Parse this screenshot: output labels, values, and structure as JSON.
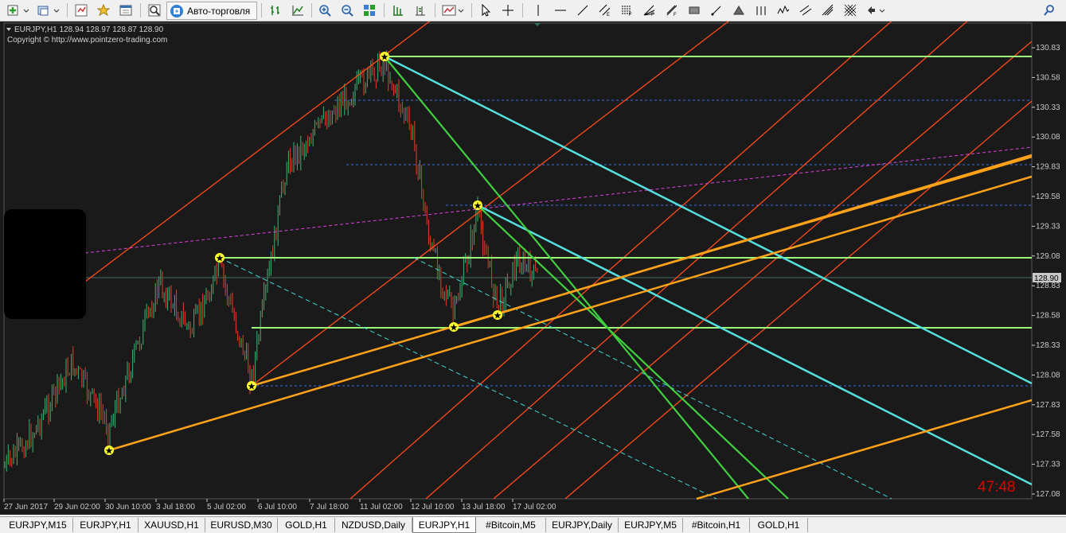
{
  "toolbar": {
    "autotrade_label": "Авто-торговля",
    "icons": [
      "new-order-icon",
      "profiles-icon",
      "market-watch-icon",
      "navigator-icon",
      "terminal-icon",
      "strategy-tester-icon",
      "autotrade-icon",
      "bar-chart-icon",
      "candles-icon",
      "line-chart-icon",
      "zoom-in-icon",
      "zoom-out-icon",
      "tile-windows-icon",
      "auto-scroll-icon",
      "chart-shift-icon",
      "indicators-icon",
      "periods-icon",
      "cursor-icon",
      "crosshair-icon",
      "vertical-line-icon",
      "horizontal-line-icon",
      "trendline-icon",
      "equidistant-channel-icon",
      "fibo-retracement-icon",
      "fibo-fan-icon",
      "rectangle-icon",
      "triangle-icon",
      "arrows-icon",
      "gann-grid-icon",
      "search-icon"
    ]
  },
  "chart": {
    "header": "EURJPY,H1  128.94 128.97 128.87 128.90",
    "copyright": "Copyright © http://www.pointzero-trading.com",
    "timer": "47:48",
    "current_price": "128.90",
    "price_labels": [
      "130.83",
      "130.58",
      "130.33",
      "130.08",
      "129.83",
      "129.58",
      "129.33",
      "129.08",
      "128.83",
      "128.58",
      "128.33",
      "128.08",
      "127.83",
      "127.58",
      "127.33",
      "127.08"
    ],
    "time_labels": [
      "27 Jun 2017",
      "29 Jun 02:00",
      "30 Jun 10:00",
      "3 Jul 18:00",
      "5 Jul 02:00",
      "6 Jul 10:00",
      "7 Jul 18:00",
      "11 Jul 02:00",
      "12 Jul 10:00",
      "13 Jul 18:00",
      "17 Jul 02:00"
    ],
    "colors": {
      "background": "#1a1a1a",
      "bull_candle": "#3cb371",
      "bear_candle": "#e0402a",
      "grid_text": "#c8c8c8",
      "timer": "#e00000"
    },
    "chart_data": {
      "type": "candlestick",
      "symbol": "EURJPY",
      "timeframe": "H1",
      "last": {
        "open": 128.94,
        "high": 128.97,
        "low": 128.87,
        "close": 128.9
      },
      "ylim": [
        127.08,
        130.83
      ],
      "x": [
        "27 Jun 2017",
        "29 Jun 02:00",
        "30 Jun 10:00",
        "3 Jul 18:00",
        "5 Jul 02:00",
        "6 Jul 10:00",
        "7 Jul 18:00",
        "11 Jul 02:00",
        "12 Jul 10:00",
        "13 Jul 18:00",
        "17 Jul 02:00"
      ]
    }
  },
  "tabs": [
    {
      "label": "EURJPY,M15",
      "active": false
    },
    {
      "label": "EURJPY,H1",
      "active": false
    },
    {
      "label": "XAUUSD,H1",
      "active": false
    },
    {
      "label": "EURUSD,M30",
      "active": false
    },
    {
      "label": "GOLD,H1",
      "active": false
    },
    {
      "label": "NZDUSD,Daily",
      "active": false
    },
    {
      "label": "EURJPY,H1",
      "active": true
    },
    {
      "label": "#Bitcoin,M5",
      "active": false
    },
    {
      "label": "EURJPY,Daily",
      "active": false
    },
    {
      "label": "EURJPY,M5",
      "active": false
    },
    {
      "label": "#Bitcoin,H1",
      "active": false
    },
    {
      "label": "GOLD,H1",
      "active": false
    }
  ]
}
